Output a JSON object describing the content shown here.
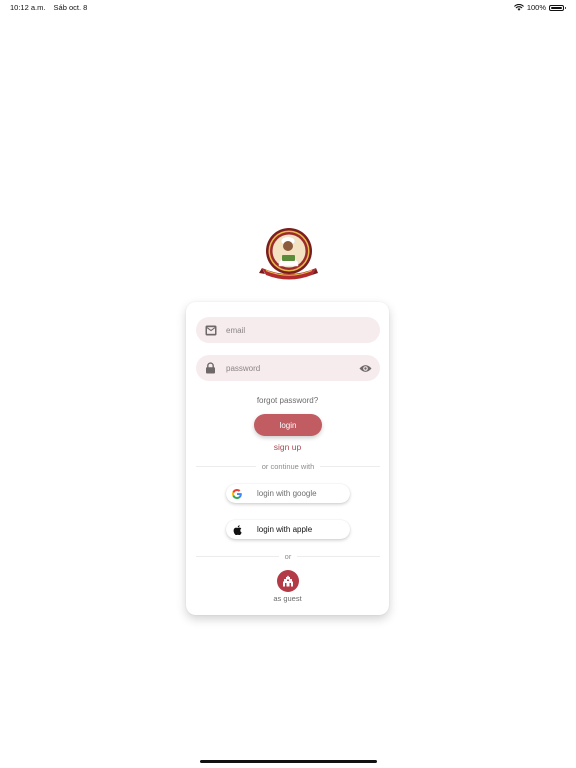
{
  "status_bar": {
    "time": "10:12 a.m.",
    "date": "Sáb oct. 8",
    "battery": "100%",
    "wifi_icon": "wifi-icon",
    "battery_icon": "battery-icon"
  },
  "logo": {
    "icon": "restaurant-logo"
  },
  "login_form": {
    "email": {
      "value": "",
      "placeholder": "email",
      "icon": "mail-icon"
    },
    "password": {
      "value": "",
      "placeholder": "password",
      "icon": "lock-icon",
      "toggle_icon": "eye-icon"
    },
    "forgot_label": "forgot password?",
    "login_label": "login",
    "signup_label": "sign up",
    "continue_with_label": "or continue with",
    "google_label": "login with google",
    "apple_label": "login with apple",
    "or_label": "or",
    "guest_label": "as guest",
    "guest_icon": "store-icon"
  },
  "colors": {
    "accent": "#c05c62",
    "signup_text": "#a84b52",
    "guest_button": "#b33a47",
    "field_bg": "#f6eced"
  }
}
